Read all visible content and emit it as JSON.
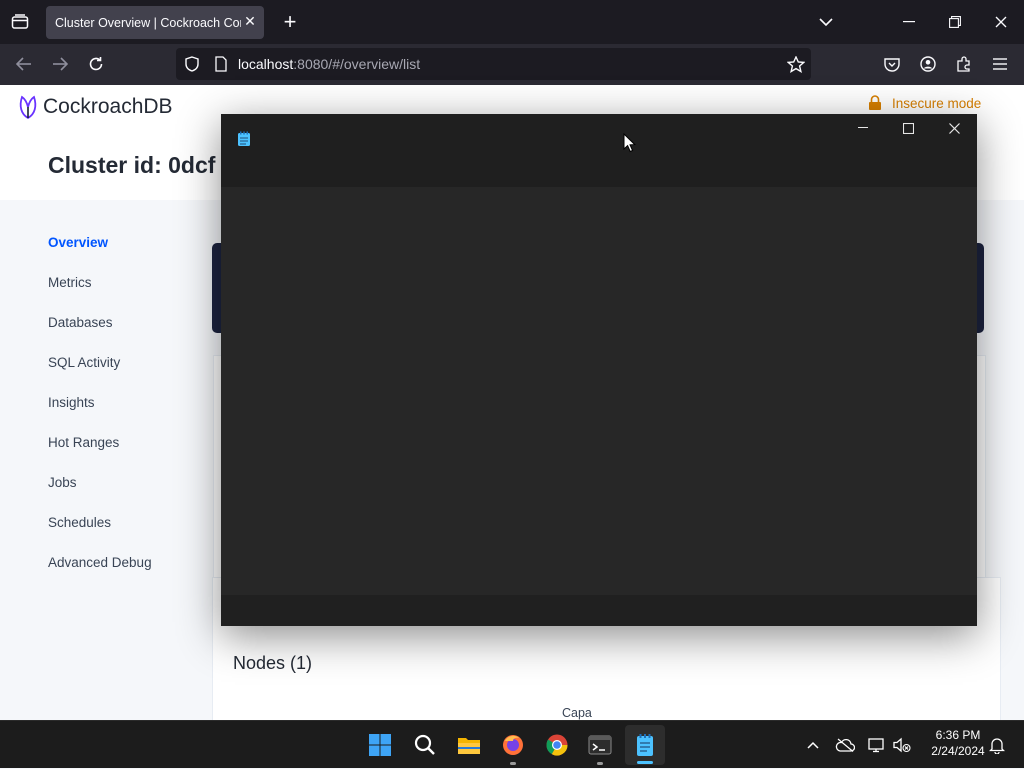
{
  "browser": {
    "tab_title": "Cluster Overview | Cockroach Console",
    "url_host": "localhost",
    "url_rest": ":8080/#/overview/list"
  },
  "app": {
    "logo_text": "CockroachDB",
    "insecure_label": "Insecure mode",
    "cluster_title": "Cluster id: 0dcf",
    "nav": [
      {
        "label": "Overview",
        "active": true
      },
      {
        "label": "Metrics"
      },
      {
        "label": "Databases"
      },
      {
        "label": "SQL Activity"
      },
      {
        "label": "Insights"
      },
      {
        "label": "Hot Ranges"
      },
      {
        "label": "Jobs"
      },
      {
        "label": "Schedules"
      },
      {
        "label": "Advanced Debug"
      }
    ],
    "nodes_title": "Nodes (1)",
    "capacity_label": "Capa"
  },
  "notepad": {
    "icon": "notepad-icon"
  },
  "taskbar": {
    "time": "6:36 PM",
    "date": "2/24/2024",
    "apps": [
      "start-icon",
      "search-icon",
      "file-explorer-icon",
      "firefox-icon",
      "chrome-icon",
      "terminal-icon",
      "notepad-icon"
    ]
  },
  "colors": {
    "accent": "#0055ff",
    "warning": "#d77f00",
    "banner": "#1d2440"
  }
}
